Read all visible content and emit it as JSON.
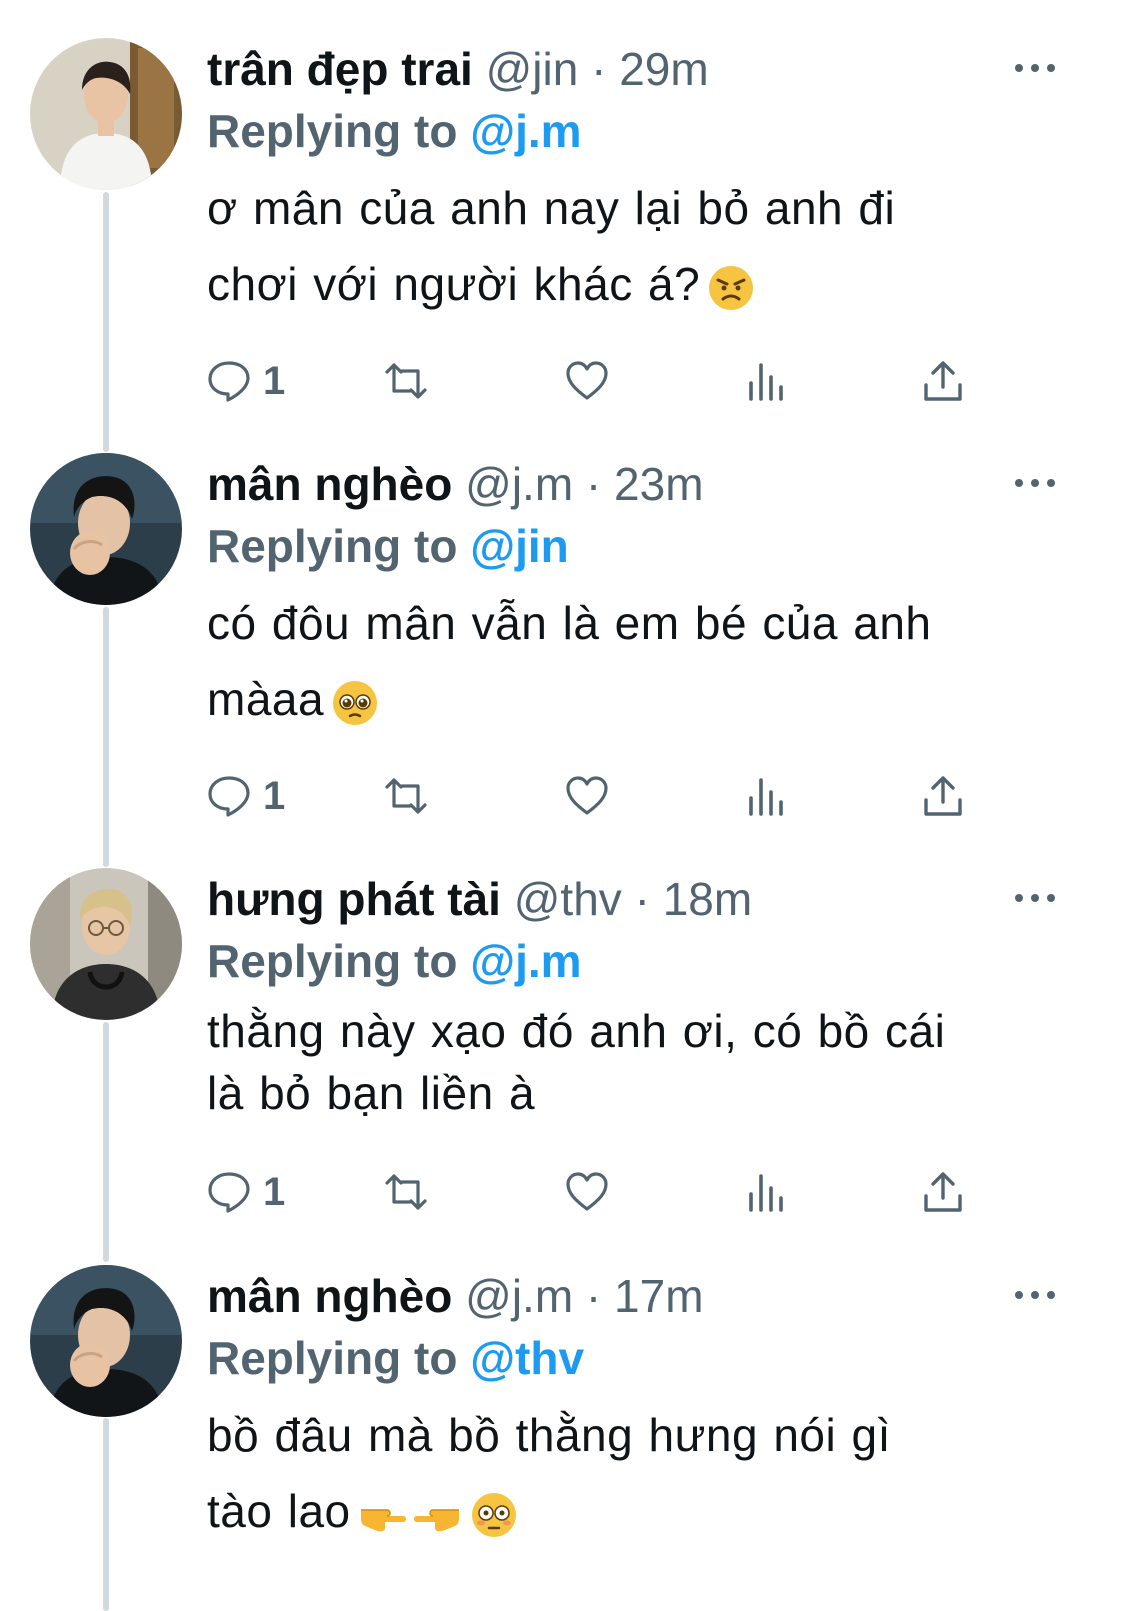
{
  "colors": {
    "text_primary": "#0f1419",
    "text_secondary": "#536471",
    "accent": "#1d9bf0",
    "thread_line": "#cfd9de"
  },
  "tweets": [
    {
      "display_name": "trân đẹp trai",
      "handle": "@jin",
      "separator": "·",
      "time": "29m",
      "replying_prefix": "Replying to",
      "replying_to": "@j.m",
      "text_lines": [
        "ơ mân của anh nay lại bỏ anh đi",
        "chơi với người khác á?"
      ],
      "emoji": [
        "angry-face"
      ],
      "reply_count": "1",
      "avatar_icon": "avatar-jin"
    },
    {
      "display_name": "mân nghèo",
      "handle": "@j.m",
      "separator": "·",
      "time": "23m",
      "replying_prefix": "Replying to",
      "replying_to": "@jin",
      "text_lines": [
        "có đôu mân vẫn là em bé của anh",
        "màaa"
      ],
      "emoji": [
        "pleading-face"
      ],
      "reply_count": "1",
      "avatar_icon": "avatar-jm"
    },
    {
      "display_name": "hưng phát tài",
      "handle": "@thv",
      "separator": "·",
      "time": "18m",
      "replying_prefix": "Replying to",
      "replying_to": "@j.m",
      "text_lines": [
        "thằng này xạo đó anh ơi, có bồ cái",
        "là bỏ bạn liền à"
      ],
      "emoji": [],
      "reply_count": "1",
      "avatar_icon": "avatar-thv"
    },
    {
      "display_name": "mân nghèo",
      "handle": "@j.m",
      "separator": "·",
      "time": "17m",
      "replying_prefix": "Replying to",
      "replying_to": "@thv",
      "text_lines": [
        "bồ đâu mà bồ thằng hưng nói gì",
        "tào lao"
      ],
      "emoji": [
        "point-right",
        "point-left",
        "flushed-face"
      ],
      "reply_count": "",
      "avatar_icon": "avatar-jm"
    }
  ]
}
